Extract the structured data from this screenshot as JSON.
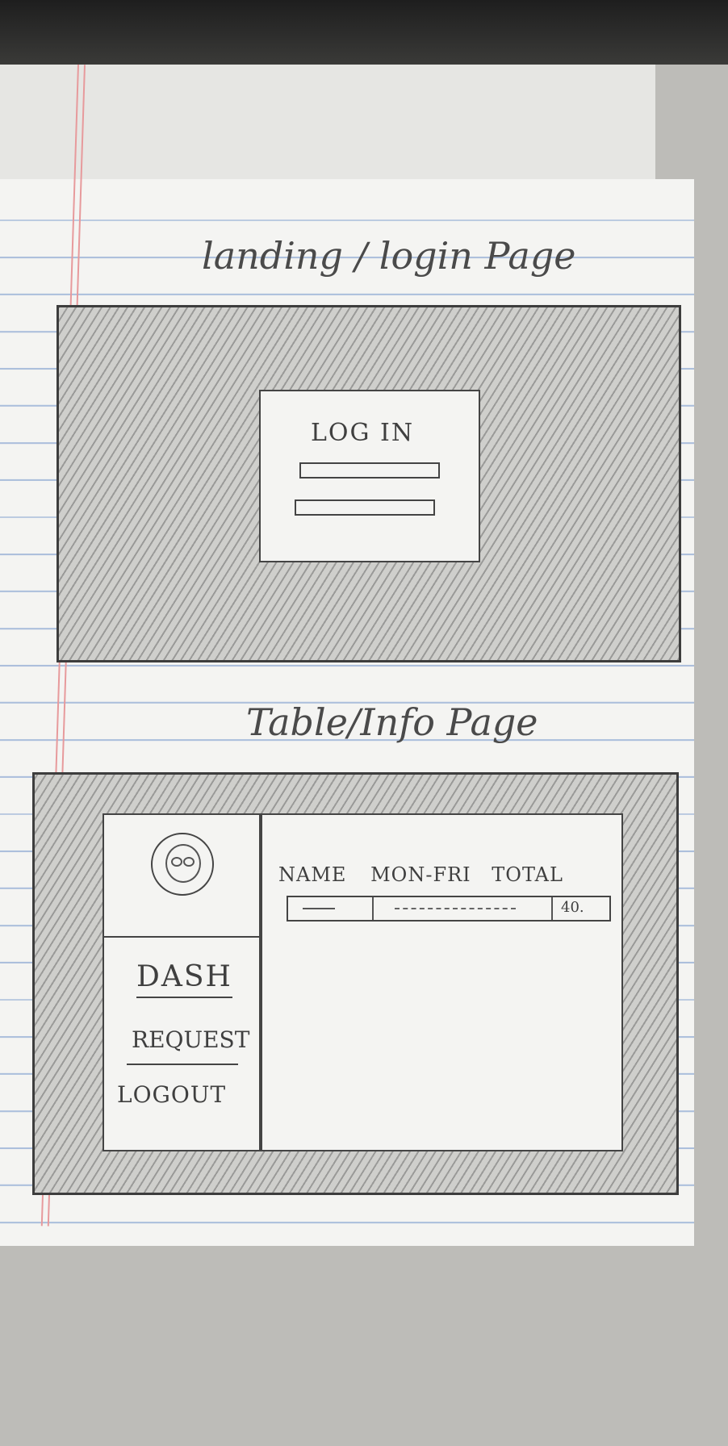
{
  "login_sketch": {
    "heading": "landing / login Page",
    "login_label": "LOG IN"
  },
  "table_sketch": {
    "heading": "Table/Info Page",
    "columns": [
      "NAME",
      "MON-FRI",
      "TOTAL"
    ],
    "row_total": "40.",
    "nav": {
      "dash": "DASH",
      "request": "REQUEST",
      "logout": "LOGOUT"
    }
  }
}
